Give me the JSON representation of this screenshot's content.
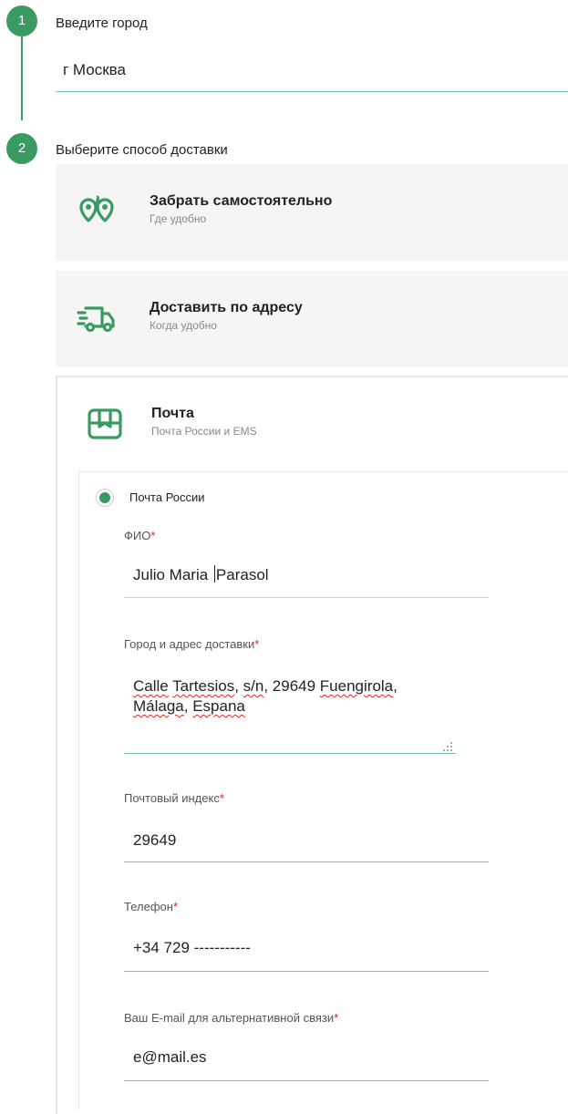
{
  "steps": [
    {
      "number": "1",
      "title": "Введите город"
    },
    {
      "number": "2",
      "title": "Выберите способ доставки"
    }
  ],
  "city": {
    "value": "г Москва"
  },
  "delivery_options": [
    {
      "icon": "map-pins-icon",
      "title": "Забрать самостоятельно",
      "subtitle": "Где удобно"
    },
    {
      "icon": "delivery-truck-icon",
      "title": "Доставить по адресу",
      "subtitle": "Когда удобно"
    },
    {
      "icon": "mail-box-icon",
      "title": "Почта",
      "subtitle": "Почта России и EMS"
    }
  ],
  "post_option": {
    "label": "Почта России",
    "selected": true
  },
  "form": {
    "name": {
      "label": "ФИО",
      "required_mark": "*",
      "value_before_caret": "Julio Maria ",
      "value_after_caret": "Parasol"
    },
    "address": {
      "label": "Город и адрес доставки",
      "required_mark": "*",
      "line1_a": "Calle",
      "line1_b": "Tartesios",
      "line1_c": ", ",
      "line1_d": "s/n",
      "line1_e": ", 29649 ",
      "line1_f": "Fuengirola",
      "line1_g": ",",
      "line2_a": "Málaga",
      "line2_b": ", ",
      "line2_c": "Espana"
    },
    "postcode": {
      "label": "Почтовый индекс",
      "required_mark": "*",
      "value": "29649"
    },
    "phone": {
      "label": "Телефон",
      "required_mark": "*",
      "value": "+34 729 -----------"
    },
    "email": {
      "label": "Ваш E-mail для альтернативной связи",
      "required_mark": "*",
      "value": "e@mail.es"
    }
  },
  "colors": {
    "accent": "#3a9b62",
    "required": "#e0261f",
    "option_bg": "#f5f5f5"
  }
}
